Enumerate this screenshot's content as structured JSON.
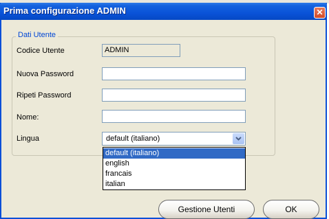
{
  "window": {
    "title": "Prima configurazione ADMIN",
    "close_glyph": "✕"
  },
  "group": {
    "legend": "Dati Utente"
  },
  "fields": {
    "codice_label": "Codice Utente",
    "codice_value": "ADMIN",
    "nuova_password_label": "Nuova Password",
    "nuova_password_value": "",
    "ripeti_password_label": "Ripeti Password",
    "ripeti_password_value": "",
    "nome_label": "Nome:",
    "nome_value": "",
    "lingua_label": "Lingua",
    "lingua_value": "default (italiano)"
  },
  "dropdown": {
    "options": [
      "default (italiano)",
      "english",
      "francais",
      "italian"
    ],
    "selected_index": 0
  },
  "buttons": {
    "gestione": "Gestione Utenti",
    "ok": "OK"
  },
  "colors": {
    "title_bar": "#0a53d8",
    "selection": "#316ac5",
    "dialog_bg": "#ece9d8",
    "legend_text": "#0046d5"
  }
}
